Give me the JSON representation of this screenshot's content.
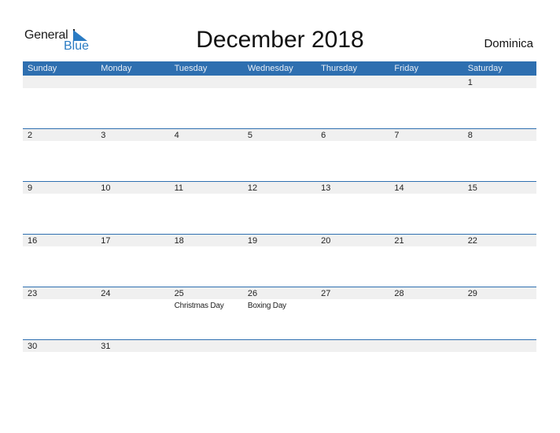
{
  "logo": {
    "general": "General",
    "blue": "Blue"
  },
  "title": "December 2018",
  "country": "Dominica",
  "colors": {
    "accent": "#2e6fb0",
    "logo_blue": "#2b7cc4",
    "day_strip": "#f0f0f0"
  },
  "weekdays": [
    "Sunday",
    "Monday",
    "Tuesday",
    "Wednesday",
    "Thursday",
    "Friday",
    "Saturday"
  ],
  "weeks": [
    {
      "days": [
        {
          "num": "",
          "holiday": ""
        },
        {
          "num": "",
          "holiday": ""
        },
        {
          "num": "",
          "holiday": ""
        },
        {
          "num": "",
          "holiday": ""
        },
        {
          "num": "",
          "holiday": ""
        },
        {
          "num": "",
          "holiday": ""
        },
        {
          "num": "1",
          "holiday": ""
        }
      ]
    },
    {
      "days": [
        {
          "num": "2",
          "holiday": ""
        },
        {
          "num": "3",
          "holiday": ""
        },
        {
          "num": "4",
          "holiday": ""
        },
        {
          "num": "5",
          "holiday": ""
        },
        {
          "num": "6",
          "holiday": ""
        },
        {
          "num": "7",
          "holiday": ""
        },
        {
          "num": "8",
          "holiday": ""
        }
      ]
    },
    {
      "days": [
        {
          "num": "9",
          "holiday": ""
        },
        {
          "num": "10",
          "holiday": ""
        },
        {
          "num": "11",
          "holiday": ""
        },
        {
          "num": "12",
          "holiday": ""
        },
        {
          "num": "13",
          "holiday": ""
        },
        {
          "num": "14",
          "holiday": ""
        },
        {
          "num": "15",
          "holiday": ""
        }
      ]
    },
    {
      "days": [
        {
          "num": "16",
          "holiday": ""
        },
        {
          "num": "17",
          "holiday": ""
        },
        {
          "num": "18",
          "holiday": ""
        },
        {
          "num": "19",
          "holiday": ""
        },
        {
          "num": "20",
          "holiday": ""
        },
        {
          "num": "21",
          "holiday": ""
        },
        {
          "num": "22",
          "holiday": ""
        }
      ]
    },
    {
      "days": [
        {
          "num": "23",
          "holiday": ""
        },
        {
          "num": "24",
          "holiday": ""
        },
        {
          "num": "25",
          "holiday": "Christmas Day"
        },
        {
          "num": "26",
          "holiday": "Boxing Day"
        },
        {
          "num": "27",
          "holiday": ""
        },
        {
          "num": "28",
          "holiday": ""
        },
        {
          "num": "29",
          "holiday": ""
        }
      ]
    },
    {
      "days": [
        {
          "num": "30",
          "holiday": ""
        },
        {
          "num": "31",
          "holiday": ""
        },
        {
          "num": "",
          "holiday": ""
        },
        {
          "num": "",
          "holiday": ""
        },
        {
          "num": "",
          "holiday": ""
        },
        {
          "num": "",
          "holiday": ""
        },
        {
          "num": "",
          "holiday": ""
        }
      ]
    }
  ]
}
